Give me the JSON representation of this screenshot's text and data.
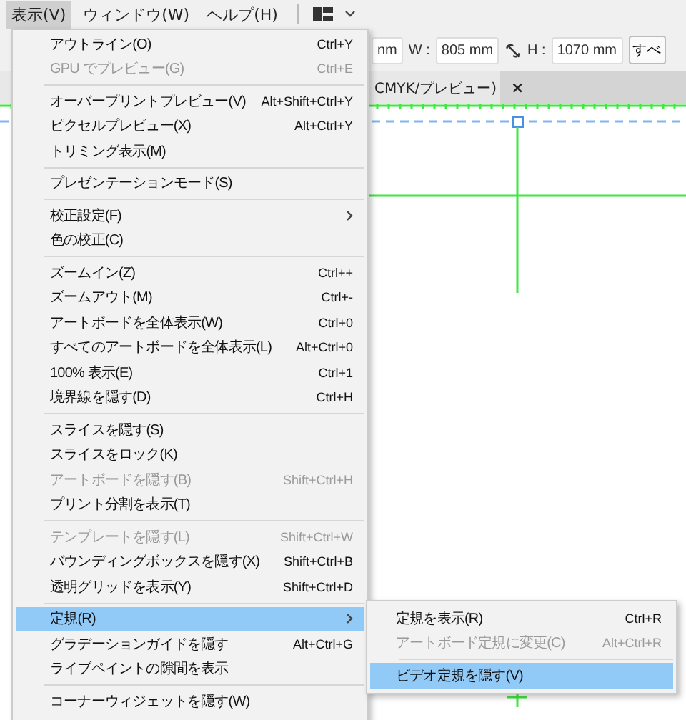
{
  "menubar": [
    {
      "label": "表示(V)",
      "selected": true
    },
    {
      "label": "ウィンドウ(W)",
      "selected": false
    },
    {
      "label": "ヘルプ(H)",
      "selected": false
    }
  ],
  "toolbar": {
    "x_value": "nm",
    "w_label": "W :",
    "w_value": "805 mm",
    "h_label": "H :",
    "h_value": "1070 mm",
    "button": "すべ"
  },
  "document_tab": {
    "title": "CMYK/プレビュー)",
    "close": "×"
  },
  "menu": [
    {
      "kind": "item",
      "label": "アウトライン(O)",
      "shortcut": "Ctrl+Y",
      "disabled": false,
      "selected": false,
      "submenu": false
    },
    {
      "kind": "item",
      "label": "GPU でプレビュー(G)",
      "shortcut": "Ctrl+E",
      "disabled": true,
      "selected": false,
      "submenu": false
    },
    {
      "kind": "separator"
    },
    {
      "kind": "item",
      "label": "オーバープリントプレビュー(V)",
      "shortcut": "Alt+Shift+Ctrl+Y",
      "disabled": false,
      "selected": false,
      "submenu": false
    },
    {
      "kind": "item",
      "label": "ピクセルプレビュー(X)",
      "shortcut": "Alt+Ctrl+Y",
      "disabled": false,
      "selected": false,
      "submenu": false
    },
    {
      "kind": "item",
      "label": "トリミング表示(M)",
      "disabled": false,
      "selected": false,
      "submenu": false
    },
    {
      "kind": "separator"
    },
    {
      "kind": "item",
      "label": "プレゼンテーションモード(S)",
      "disabled": false,
      "selected": false,
      "submenu": false
    },
    {
      "kind": "separator"
    },
    {
      "kind": "item",
      "label": "校正設定(F)",
      "disabled": false,
      "selected": false,
      "submenu": true
    },
    {
      "kind": "item",
      "label": "色の校正(C)",
      "disabled": false,
      "selected": false,
      "submenu": false
    },
    {
      "kind": "separator"
    },
    {
      "kind": "item",
      "label": "ズームイン(Z)",
      "shortcut": "Ctrl++",
      "disabled": false,
      "selected": false,
      "submenu": false
    },
    {
      "kind": "item",
      "label": "ズームアウト(M)",
      "shortcut": "Ctrl+-",
      "disabled": false,
      "selected": false,
      "submenu": false
    },
    {
      "kind": "item",
      "label": "アートボードを全体表示(W)",
      "shortcut": "Ctrl+0",
      "disabled": false,
      "selected": false,
      "submenu": false
    },
    {
      "kind": "item",
      "label": "すべてのアートボードを全体表示(L)",
      "shortcut": "Alt+Ctrl+0",
      "disabled": false,
      "selected": false,
      "submenu": false
    },
    {
      "kind": "item",
      "label": "100% 表示(E)",
      "shortcut": "Ctrl+1",
      "disabled": false,
      "selected": false,
      "submenu": false
    },
    {
      "kind": "item",
      "label": "境界線を隠す(D)",
      "shortcut": "Ctrl+H",
      "disabled": false,
      "selected": false,
      "submenu": false
    },
    {
      "kind": "separator"
    },
    {
      "kind": "item",
      "label": "スライスを隠す(S)",
      "disabled": false,
      "selected": false,
      "submenu": false
    },
    {
      "kind": "item",
      "label": "スライスをロック(K)",
      "disabled": false,
      "selected": false,
      "submenu": false
    },
    {
      "kind": "item",
      "label": "アートボードを隠す(B)",
      "shortcut": "Shift+Ctrl+H",
      "disabled": true,
      "selected": false,
      "submenu": false
    },
    {
      "kind": "item",
      "label": "プリント分割を表示(T)",
      "disabled": false,
      "selected": false,
      "submenu": false
    },
    {
      "kind": "separator"
    },
    {
      "kind": "item",
      "label": "テンプレートを隠す(L)",
      "shortcut": "Shift+Ctrl+W",
      "disabled": true,
      "selected": false,
      "submenu": false
    },
    {
      "kind": "item",
      "label": "バウンディングボックスを隠す(X)",
      "shortcut": "Shift+Ctrl+B",
      "disabled": false,
      "selected": false,
      "submenu": false
    },
    {
      "kind": "item",
      "label": "透明グリッドを表示(Y)",
      "shortcut": "Shift+Ctrl+D",
      "disabled": false,
      "selected": false,
      "submenu": false
    },
    {
      "kind": "separator"
    },
    {
      "kind": "item",
      "label": "定規(R)",
      "disabled": false,
      "selected": true,
      "submenu": true
    },
    {
      "kind": "item",
      "label": "グラデーションガイドを隠す",
      "shortcut": "Alt+Ctrl+G",
      "disabled": false,
      "selected": false,
      "submenu": false
    },
    {
      "kind": "item",
      "label": "ライブペイントの隙間を表示",
      "disabled": false,
      "selected": false,
      "submenu": false
    },
    {
      "kind": "separator"
    },
    {
      "kind": "item",
      "label": "コーナーウィジェットを隠す(W)",
      "disabled": false,
      "selected": false,
      "submenu": false
    }
  ],
  "submenu": [
    {
      "kind": "item",
      "label": "定規を表示(R)",
      "shortcut": "Ctrl+R",
      "disabled": false,
      "selected": false
    },
    {
      "kind": "item",
      "label": "アートボード定規に変更(C)",
      "shortcut": "Alt+Ctrl+R",
      "disabled": true,
      "selected": false
    },
    {
      "kind": "separator"
    },
    {
      "kind": "item",
      "label": "ビデオ定規を隠す(V)",
      "disabled": false,
      "selected": true
    }
  ]
}
